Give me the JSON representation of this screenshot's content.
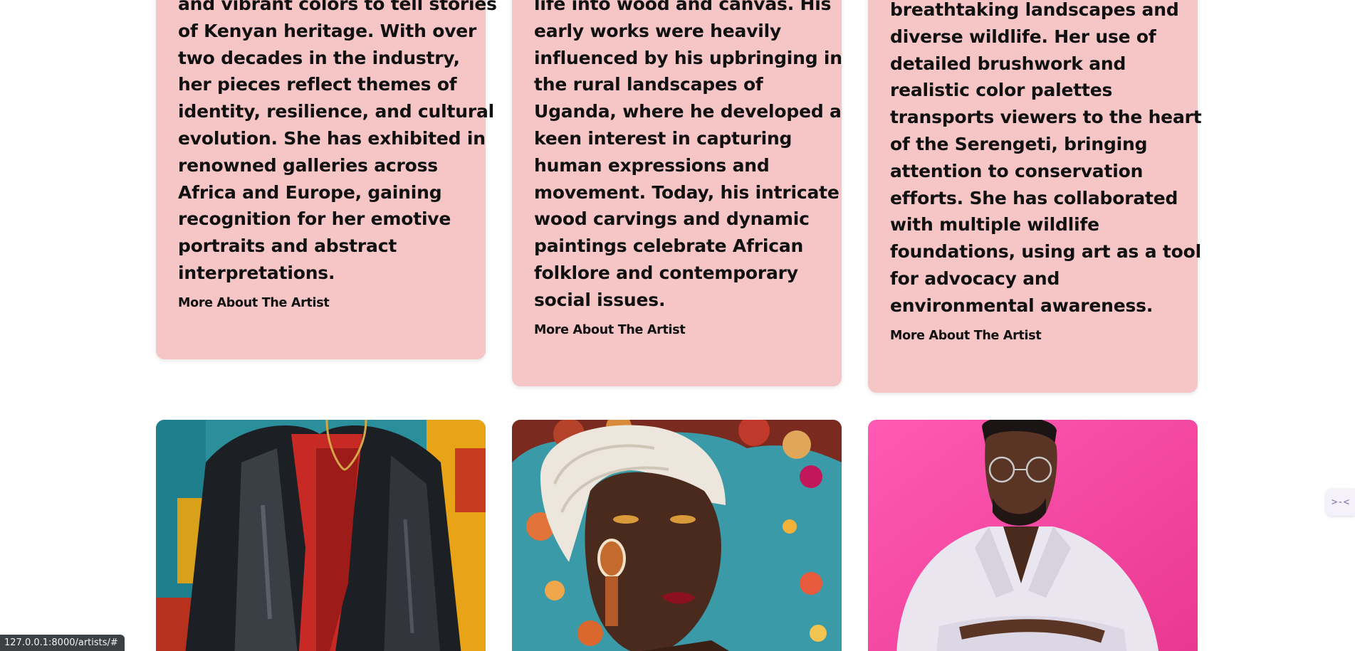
{
  "cards": [
    {
      "bio_lines": [
        "and vibrant colors to tell stories",
        "of Kenyan heritage. With over",
        "two decades in the industry,",
        "her pieces reflect themes of",
        "identity, resilience, and cultural",
        "evolution. She has exhibited in",
        "renowned galleries across",
        "Africa and Europe, gaining",
        "recognition for her emotive",
        "portraits and abstract",
        "interpretations."
      ],
      "more_label": "More About The Artist"
    },
    {
      "bio_lines": [
        "life into wood and canvas. His",
        "early works were heavily",
        "influenced by his upbringing in",
        "the rural landscapes of",
        "Uganda, where he developed a",
        "keen interest in capturing",
        "human expressions and",
        "movement. Today, his intricate",
        "wood carvings and dynamic",
        "paintings celebrate African",
        "folklore and contemporary",
        "social issues."
      ],
      "more_label": "More About The Artist"
    },
    {
      "bio_lines": [
        "breathtaking landscapes and",
        "diverse wildlife. Her use of",
        "detailed brushwork and",
        "realistic color palettes",
        "transports viewers to the heart",
        "of the Serengeti, bringing",
        "attention to conservation",
        "efforts. She has collaborated",
        "with multiple wildlife",
        "foundations, using art as a tool",
        "for advocacy and",
        "environmental awareness."
      ],
      "more_label": "More About The Artist"
    }
  ],
  "photos": [
    {
      "icon": "painted-portrait-image"
    },
    {
      "icon": "headwrap-portrait-image"
    },
    {
      "icon": "pink-backdrop-portrait-image"
    }
  ],
  "status_bar": {
    "url": "127.0.0.1:8000/artists/#"
  },
  "side_widget": {
    "icon": "chevron-collapse-icon",
    "glyph": ">-<"
  },
  "colors": {
    "card_background": "#f6c6c6",
    "text": "#111111",
    "status_bar": "#3c4043"
  }
}
